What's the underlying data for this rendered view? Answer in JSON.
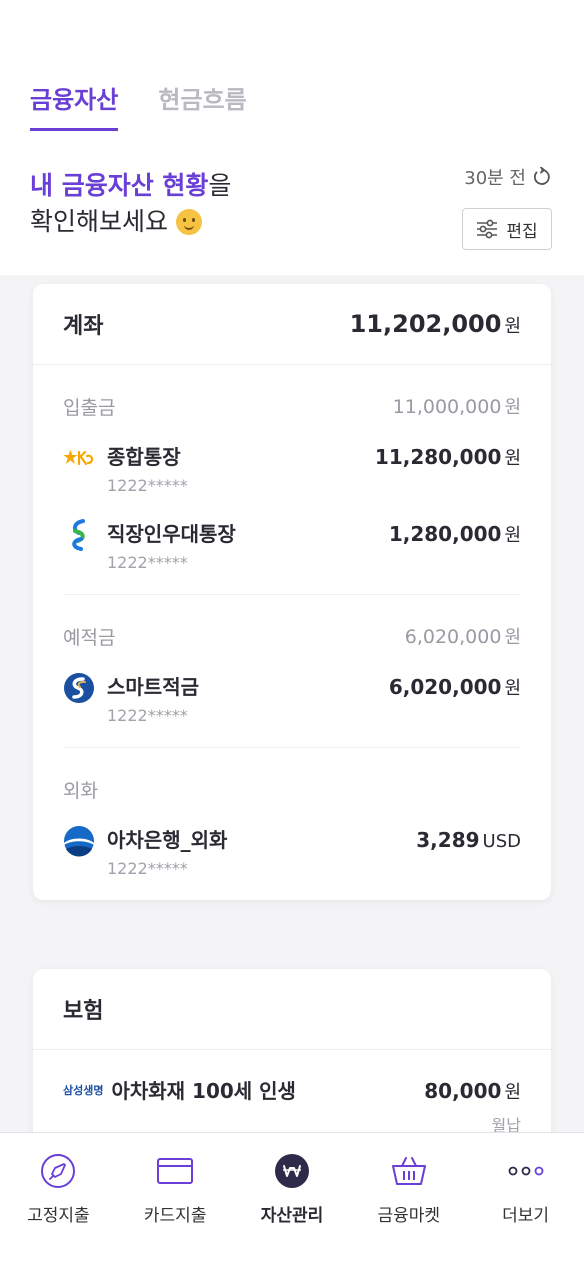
{
  "tabs": [
    {
      "label": "금융자산"
    },
    {
      "label": "현금흐름"
    }
  ],
  "headline": {
    "highlight": "내 금융자산 현황",
    "suffix": "을",
    "line2": "확인해보세요"
  },
  "updated": "30분 전",
  "edit_label": "편집",
  "accounts": {
    "title": "계좌",
    "total": "11,202,000",
    "currency": "원",
    "sections": [
      {
        "title": "입출금",
        "total": "11,000,000",
        "unit": "원",
        "items": [
          {
            "name": "종합통장",
            "number": "1222*****",
            "amount": "11,280,000",
            "unit": "원",
            "logo": "kb-star-icon"
          },
          {
            "name": "직장인우대통장",
            "number": "1222*****",
            "amount": "1,280,000",
            "unit": "원",
            "logo": "standard-chartered-icon"
          }
        ]
      },
      {
        "title": "예적금",
        "total": "6,020,000",
        "unit": "원",
        "items": [
          {
            "name": "스마트적금",
            "number": "1222*****",
            "amount": "6,020,000",
            "unit": "원",
            "logo": "shinhan-icon"
          }
        ]
      },
      {
        "title": "외화",
        "total": "",
        "unit": "",
        "items": [
          {
            "name": "아차은행_외화",
            "number": "1222*****",
            "amount": "3,289",
            "unit": "USD",
            "logo": "bank-globe-icon"
          }
        ]
      }
    ]
  },
  "insurance": {
    "title": "보험",
    "items": [
      {
        "brand": "삼성생명",
        "name": "아차화재 100세 인생",
        "amount": "80,000",
        "unit": "원",
        "note": "월납"
      }
    ]
  },
  "nav": [
    {
      "label": "고정지출",
      "icon": "rocket-icon"
    },
    {
      "label": "카드지출",
      "icon": "card-icon"
    },
    {
      "label": "자산관리",
      "icon": "won-icon",
      "active": true
    },
    {
      "label": "금융마켓",
      "icon": "basket-icon"
    },
    {
      "label": "더보기",
      "icon": "more-icon"
    }
  ],
  "colors": {
    "accent": "#6a3fd6",
    "muted": "#9a9aa3",
    "text": "#2a2a33"
  }
}
